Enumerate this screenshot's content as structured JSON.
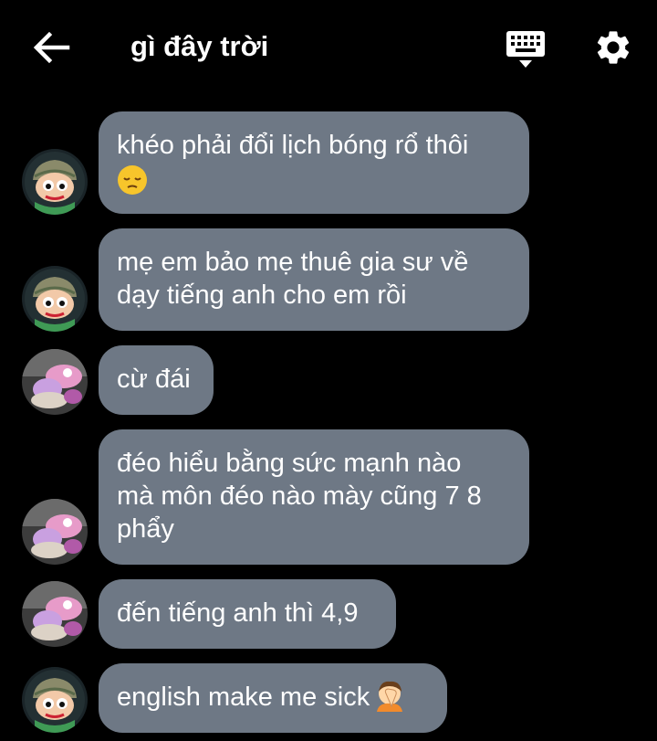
{
  "header": {
    "title": "gì đây trời",
    "back_icon": "arrow-left-icon",
    "keyboard_icon": "keyboard-icon",
    "settings_icon": "gear-icon"
  },
  "colors": {
    "background": "#000000",
    "bubble": "#6e7885",
    "text": "#ffffff"
  },
  "messages": [
    {
      "text": "khéo phải đổi lịch bóng rổ thôi",
      "emoji": "pensive-face-emoji",
      "avatar": "cartoon-boy-avatar"
    },
    {
      "text": "mẹ em bảo mẹ thuê gia sư về\ndạy tiếng anh cho em rồi",
      "avatar": "cartoon-boy-avatar"
    },
    {
      "text": "cừ đái",
      "avatar": "plush-toys-avatar"
    },
    {
      "text": "đéo hiểu bằng sức mạnh nào\nmà môn đéo nào mày cũng 7 8\nphẩy",
      "avatar": "plush-toys-avatar"
    },
    {
      "text": "đến tiếng anh thì 4,9",
      "avatar": "plush-toys-avatar"
    },
    {
      "text": "english make me sick",
      "emoji": "person-facepalming-emoji",
      "avatar": "cartoon-boy-avatar"
    }
  ]
}
